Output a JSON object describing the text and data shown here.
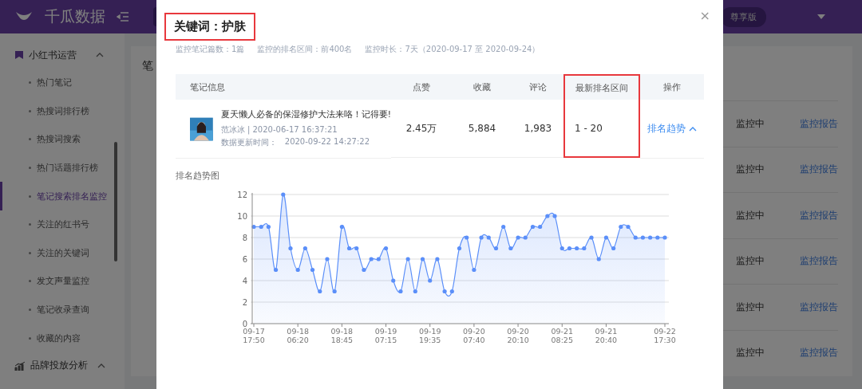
{
  "app": {
    "logo": "千瓜数据",
    "plan_badge": "尊享版",
    "sidebar": {
      "groups": [
        {
          "label": "小红书运营",
          "expanded": true,
          "items": [
            {
              "label": "热门笔记",
              "selected": false
            },
            {
              "label": "热搜词排行榜",
              "selected": false
            },
            {
              "label": "热搜词搜索",
              "selected": false
            },
            {
              "label": "热门话题排行榜",
              "selected": false
            },
            {
              "label": "笔记搜索排名监控",
              "selected": true
            },
            {
              "label": "关注的红书号",
              "selected": false
            },
            {
              "label": "关注的关键词",
              "selected": false
            },
            {
              "label": "发文声量监控",
              "selected": false
            },
            {
              "label": "笔记收录查询",
              "selected": false
            },
            {
              "label": "收藏的内容",
              "selected": false
            }
          ]
        },
        {
          "label": "品牌投放分析",
          "expanded": true
        }
      ]
    },
    "page_heading": "笔",
    "rows": [
      {
        "status": "监控中",
        "action": "监控报告"
      },
      {
        "status": "监控中",
        "action": "监控报告"
      },
      {
        "status": "监控中",
        "action": "监控报告"
      },
      {
        "status": "监控中",
        "action": "监控报告"
      },
      {
        "status": "监控中",
        "action": "监控报告"
      },
      {
        "status": "监控中",
        "action": "监控报告"
      }
    ]
  },
  "dialog": {
    "title": "关键词：护肤",
    "close": "×",
    "meta": [
      "监控笔记篇数：1篇",
      "监控的排名区间：前400名",
      "监控时长：7天（2020-09-17 至 2020-09-24）"
    ],
    "table": {
      "columns": [
        {
          "label": "笔记信息",
          "highlighted": false
        },
        {
          "label": "点赞",
          "highlighted": false
        },
        {
          "label": "收藏",
          "highlighted": false
        },
        {
          "label": "评论",
          "highlighted": false
        },
        {
          "label": "最新排名区间",
          "highlighted": true
        },
        {
          "label": "操作",
          "highlighted": false
        }
      ],
      "rows": [
        {
          "title": "夏天懒人必备的保湿修护大法来咯！记得要!",
          "author": "范冰冰 | 2020-06-17 16:37:21",
          "updated_label": "数据更新时间：",
          "updated": "2020-09-22 14:27:22",
          "likes": "2.45万",
          "favorites": "5,884",
          "comments": "1,983",
          "rank_range": "1 - 20",
          "action": "排名趋势",
          "expanded": true
        }
      ]
    },
    "chart_title": "排名趋势图",
    "chart_data": {
      "type": "area",
      "categories": [
        "09-17 17:50",
        null,
        null,
        null,
        null,
        null,
        "09-18 06:20",
        null,
        null,
        null,
        null,
        null,
        "09-18 18:45",
        null,
        null,
        null,
        null,
        null,
        "09-19 07:15",
        null,
        null,
        null,
        null,
        null,
        "09-19 19:35",
        null,
        null,
        null,
        null,
        null,
        "09-20 07:40",
        null,
        null,
        null,
        null,
        null,
        "09-20 20:10",
        null,
        null,
        null,
        null,
        null,
        "09-21 08:25",
        null,
        null,
        null,
        null,
        null,
        "09-21 20:40",
        null,
        null,
        null,
        null,
        null,
        null,
        null,
        "09-22 17:30"
      ],
      "series": [
        {
          "color": "#5b8ff9",
          "values": [
            9,
            9,
            9,
            5,
            12,
            7,
            5,
            7,
            5,
            3,
            6,
            3,
            9,
            7,
            7,
            5,
            6,
            6,
            7,
            4,
            3,
            6,
            3,
            6,
            4,
            6,
            3,
            3,
            7,
            8,
            5,
            8,
            8,
            7,
            9,
            7,
            8,
            8,
            9,
            9,
            10,
            10,
            7,
            7,
            7,
            7,
            8,
            6,
            8,
            7,
            9,
            9,
            8,
            8,
            8,
            8,
            8
          ]
        }
      ],
      "ylim": [
        0,
        12
      ],
      "yticks": [
        0,
        2,
        4,
        6,
        8,
        10,
        12
      ],
      "grid": true
    }
  }
}
